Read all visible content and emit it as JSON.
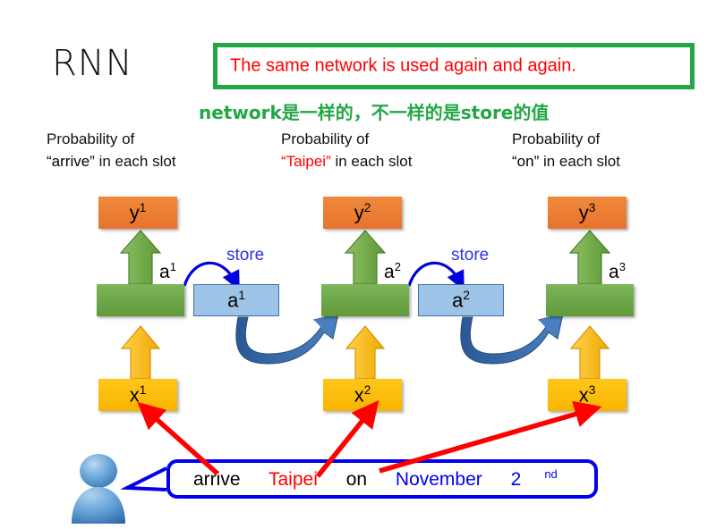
{
  "slide": {
    "title": "RNN",
    "callout": {
      "text": "The same network is used again and again.",
      "text_color": "#FF0000",
      "border_color": "#22A744"
    },
    "annotation_cn": {
      "text": "network是一样的，不一样的是store的值",
      "color": "#22A744"
    }
  },
  "captions": [
    {
      "line1": "Probability of",
      "quoted": "“arrive”",
      "line2_rest": " in each slot",
      "quoted_color": "#000000"
    },
    {
      "line1": "Probability of",
      "quoted": "“Taipei”",
      "line2_rest": " in each slot",
      "quoted_color": "#FF0000"
    },
    {
      "line1": "Probability of",
      "quoted": "“on”",
      "line2_rest": " in each slot",
      "quoted_color": "#000000"
    }
  ],
  "network": {
    "timesteps": [
      {
        "output_base": "y",
        "output_sup": "1",
        "hidden_label_base": "a",
        "hidden_label_sup": "1",
        "input_base": "x",
        "input_sup": "1",
        "store_base": "a",
        "store_sup": "1",
        "store_word": "store",
        "has_store": true
      },
      {
        "output_base": "y",
        "output_sup": "2",
        "hidden_label_base": "a",
        "hidden_label_sup": "2",
        "input_base": "x",
        "input_sup": "2",
        "store_base": "a",
        "store_sup": "2",
        "store_word": "store",
        "has_store": true
      },
      {
        "output_base": "y",
        "output_sup": "3",
        "hidden_label_base": "a",
        "hidden_label_sup": "3",
        "input_base": "x",
        "input_sup": "3",
        "store_base": "",
        "store_sup": "",
        "store_word": "",
        "has_store": false
      }
    ],
    "colors": {
      "output_box": "#ED7D31",
      "hidden_box": "#70AD47",
      "input_box": "#FFC000",
      "store_box": "#9DC3E6",
      "store_border": "#3F6FA8",
      "store_arrow": "#0000DD",
      "recurrent_arrow": "#31628F",
      "up_arrow_green": "#70AD47",
      "up_arrow_yellow": "#FFC000",
      "mapping_arrow": "#FF0000"
    }
  },
  "sentence": {
    "words": [
      {
        "text": "arrive",
        "color": "#000000",
        "sup": ""
      },
      {
        "text": "Taipei",
        "color": "#FF0000",
        "sup": ""
      },
      {
        "text": "on",
        "color": "#000000",
        "sup": ""
      },
      {
        "text": "November",
        "color": "#0000EE",
        "sup": ""
      },
      {
        "text": "2",
        "color": "#0000EE",
        "sup": "nd"
      }
    ],
    "bubble_color": "#0000EE"
  },
  "speaker": {
    "icon": "person-avatar-icon",
    "color": "#5B9BD5"
  }
}
